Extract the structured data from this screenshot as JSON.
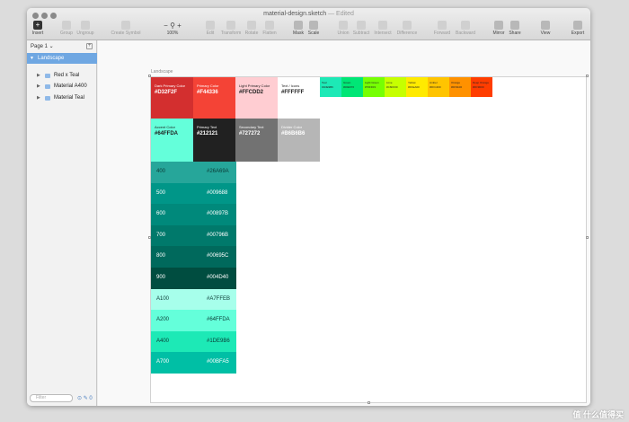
{
  "window": {
    "file_name": "material-design.sketch",
    "status": "— Edited"
  },
  "toolbar": {
    "insert": "Insert",
    "group": "Group",
    "ungroup": "Ungroup",
    "create_symbol": "Create Symbol",
    "zoom_minus": "−",
    "zoom_plus": "+",
    "zoom_level": "100%",
    "edit": "Edit",
    "transform": "Transform",
    "rotate": "Rotate",
    "flatten": "Flatten",
    "mask": "Mask",
    "scale": "Scale",
    "union": "Union",
    "subtract": "Subtract",
    "intersect": "Intersect",
    "difference": "Difference",
    "forward": "Forward",
    "backward": "Backward",
    "mirror": "Mirror",
    "share": "Share",
    "view": "View",
    "export": "Export"
  },
  "sidebar": {
    "page_selector": "Page 1 ⌄",
    "add_page": "+",
    "layers": [
      {
        "label": "Landscape",
        "selected": true
      },
      {
        "label": "Red x Teal",
        "selected": false
      },
      {
        "label": "Material A400",
        "selected": false
      },
      {
        "label": "Material Teal",
        "selected": false
      }
    ],
    "filter_placeholder": "Filter",
    "filter_icons": "⊙ ✎ 0"
  },
  "canvas": {
    "artboard_label": "Landscape",
    "primary_swatches": [
      {
        "name": "Dark Primary Color",
        "hex": "#D32F2F",
        "bg": "#d32f2f",
        "fg": "#ffffff"
      },
      {
        "name": "Primary Color",
        "hex": "#F44336",
        "bg": "#f44336",
        "fg": "#ffffff"
      },
      {
        "name": "Light Primary Color",
        "hex": "#FFCDD2",
        "bg": "#ffcdd2",
        "fg": "#212121"
      },
      {
        "name": "Text / Icons",
        "hex": "#FFFFFF",
        "bg": "#ffffff",
        "fg": "#212121"
      }
    ],
    "accent_swatches": [
      {
        "name": "Teal",
        "hex": "#1DE9B6",
        "bg": "#1de9b6"
      },
      {
        "name": "Green",
        "hex": "#00E676",
        "bg": "#00e676"
      },
      {
        "name": "Light Green",
        "hex": "#76FF03",
        "bg": "#76ff03"
      },
      {
        "name": "Lime",
        "hex": "#C6FF00",
        "bg": "#c6ff00"
      },
      {
        "name": "Yellow",
        "hex": "#FFEA00",
        "bg": "#ffea00"
      },
      {
        "name": "Amber",
        "hex": "#FFC400",
        "bg": "#ffc400"
      },
      {
        "name": "Orange",
        "hex": "#FF9100",
        "bg": "#ff9100"
      },
      {
        "name": "Deep Orange",
        "hex": "#FF3D00",
        "bg": "#ff3d00"
      }
    ],
    "secondary_swatches": [
      {
        "name": "Accent Color",
        "hex": "#64FFDA",
        "bg": "#64ffda",
        "fg": "#212121"
      },
      {
        "name": "Primary Text",
        "hex": "#212121",
        "bg": "#212121",
        "fg": "#ffffff"
      },
      {
        "name": "Secondary Text",
        "hex": "#727272",
        "bg": "#727272",
        "fg": "#ffffff"
      },
      {
        "name": "Divider Color",
        "hex": "#B6B6B6",
        "bg": "#b6b6b6",
        "fg": "#ffffff"
      }
    ],
    "teal_shades": [
      {
        "name": "400",
        "hex": "#26A69A",
        "bg": "#26a69a",
        "fg": "#0b3b36"
      },
      {
        "name": "500",
        "hex": "#009688",
        "bg": "#009688",
        "fg": "#ffffff"
      },
      {
        "name": "600",
        "hex": "#00897B",
        "bg": "#00897b",
        "fg": "#ffffff"
      },
      {
        "name": "700",
        "hex": "#00796B",
        "bg": "#00796b",
        "fg": "#ffffff"
      },
      {
        "name": "800",
        "hex": "#00695C",
        "bg": "#00695c",
        "fg": "#ffffff"
      },
      {
        "name": "900",
        "hex": "#004D40",
        "bg": "#004d40",
        "fg": "#ffffff"
      },
      {
        "name": "A100",
        "hex": "#A7FFEB",
        "bg": "#a7ffeb",
        "fg": "#0b3b36"
      },
      {
        "name": "A200",
        "hex": "#64FFDA",
        "bg": "#64ffda",
        "fg": "#0b3b36"
      },
      {
        "name": "A400",
        "hex": "#1DE9B6",
        "bg": "#1de9b6",
        "fg": "#0b3b36"
      },
      {
        "name": "A700",
        "hex": "#00BFA5",
        "bg": "#00bfa5",
        "fg": "#ffffff"
      }
    ]
  },
  "watermark": "值 什么值得买"
}
